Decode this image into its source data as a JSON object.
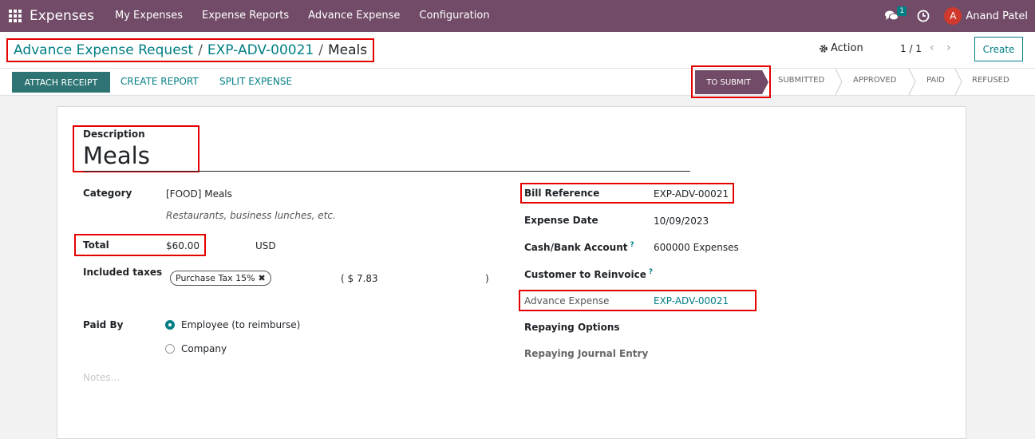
{
  "navbar": {
    "app_title": "Expenses",
    "menu": [
      "My Expenses",
      "Expense Reports",
      "Advance Expense",
      "Configuration"
    ],
    "chat_count": "1",
    "user_initial": "A",
    "user_name": "Anand Patel",
    "bg_color": "#714b67"
  },
  "breadcrumb": {
    "root": "Advance Expense Request",
    "sep1": "/",
    "record": "EXP-ADV-00021",
    "sep2": "/",
    "current": "Meals"
  },
  "control_panel": {
    "action_label": "Action",
    "pager": "1 / 1",
    "prev": "‹",
    "next": "›",
    "create_label": "Create"
  },
  "header_buttons": {
    "attach": "ATTACH RECEIPT",
    "create_report": "CREATE REPORT",
    "split": "SPLIT EXPENSE"
  },
  "stages": {
    "current": "TO SUBMIT",
    "submitted": "SUBMITTED",
    "approved": "APPROVED",
    "paid": "PAID",
    "refused": "REFUSED"
  },
  "form": {
    "description_label": "Description",
    "description_value": "Meals",
    "category_label": "Category",
    "category_value": "[FOOD] Meals",
    "category_hint": "Restaurants, business lunches, etc.",
    "total_label": "Total",
    "total_value": "$60.00",
    "currency": "USD",
    "taxes_label": "Included taxes",
    "tax_tag": "Purchase Tax 15%",
    "tax_amount_open": "( $ 7.83",
    "tax_amount_close": ")",
    "paid_by_label": "Paid By",
    "paid_by_options": [
      "Employee (to reimburse)",
      "Company"
    ],
    "paid_by_selected": "Employee (to reimburse)",
    "notes_placeholder": "Notes...",
    "bill_ref_label": "Bill Reference",
    "bill_ref_value": "EXP-ADV-00021",
    "expense_date_label": "Expense Date",
    "expense_date_value": "10/09/2023",
    "account_label": "Cash/Bank Account",
    "account_value": "600000 Expenses",
    "reinvoice_label": "Customer to Reinvoice",
    "help_marker": "?",
    "advance_label": "Advance Expense",
    "advance_value": "EXP-ADV-00021",
    "repaying_options_label": "Repaying Options",
    "repaying_entry_label": "Repaying Journal Entry"
  }
}
